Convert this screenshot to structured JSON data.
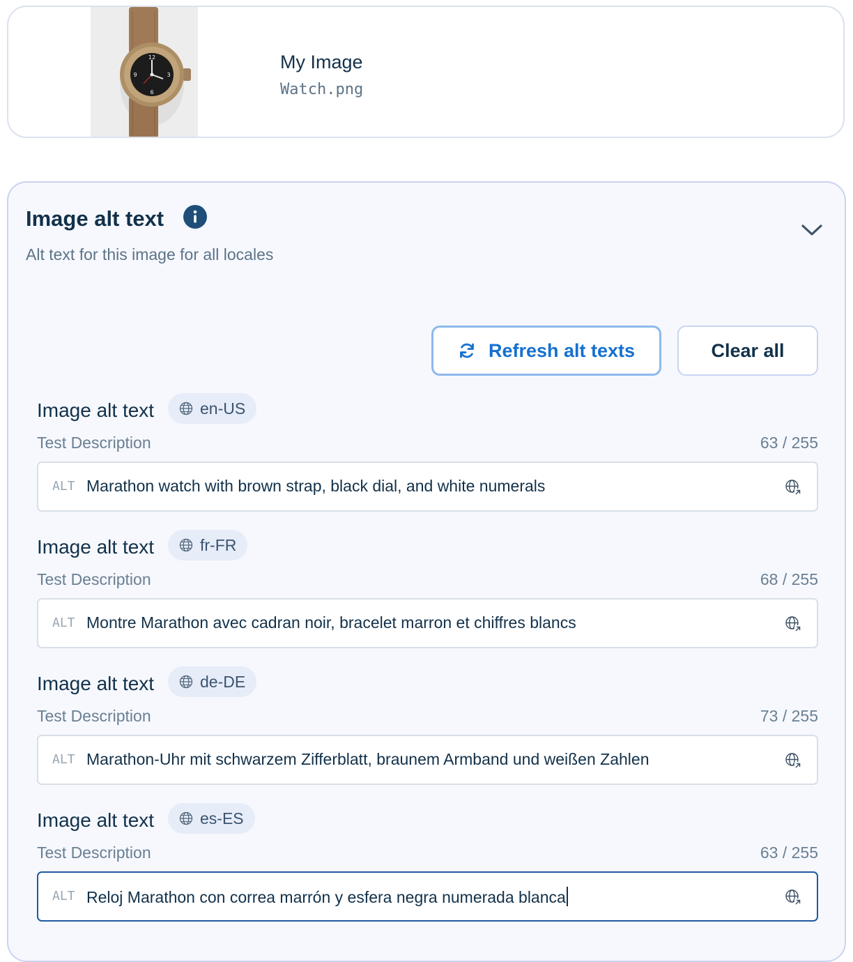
{
  "file": {
    "title": "My Image",
    "filename": "Watch.png"
  },
  "panel": {
    "title": "Image alt text",
    "subtitle": "Alt text for this image for all locales",
    "refresh_label": "Refresh alt texts",
    "clear_label": "Clear all"
  },
  "locales": [
    {
      "label": "Image alt text",
      "code": "en-US",
      "description": "Test Description",
      "count": "63 / 255",
      "prefix": "ALT",
      "value": "Marathon watch with brown strap, black dial, and white numerals"
    },
    {
      "label": "Image alt text",
      "code": "fr-FR",
      "description": "Test Description",
      "count": "68 / 255",
      "prefix": "ALT",
      "value": "Montre Marathon avec cadran noir, bracelet marron et chiffres blancs"
    },
    {
      "label": "Image alt text",
      "code": "de-DE",
      "description": "Test Description",
      "count": "73 / 255",
      "prefix": "ALT",
      "value": "Marathon-Uhr mit schwarzem Zifferblatt, braunem Armband und weißen Zahlen"
    },
    {
      "label": "Image alt text",
      "code": "es-ES",
      "description": "Test Description",
      "count": "63 / 255",
      "prefix": "ALT",
      "value": "Reloj Marathon con correa marrón y esfera negra numerada blanca"
    }
  ],
  "colors": {
    "accent": "#1670d0",
    "text": "#12314a",
    "muted": "#5d7387",
    "panel_bg": "#f6f8fd",
    "active_border": "#1f5a9f"
  },
  "icons": [
    "watch-thumbnail",
    "info-icon",
    "chevron-down-icon",
    "refresh-icon",
    "globe-icon",
    "translate-icon"
  ]
}
